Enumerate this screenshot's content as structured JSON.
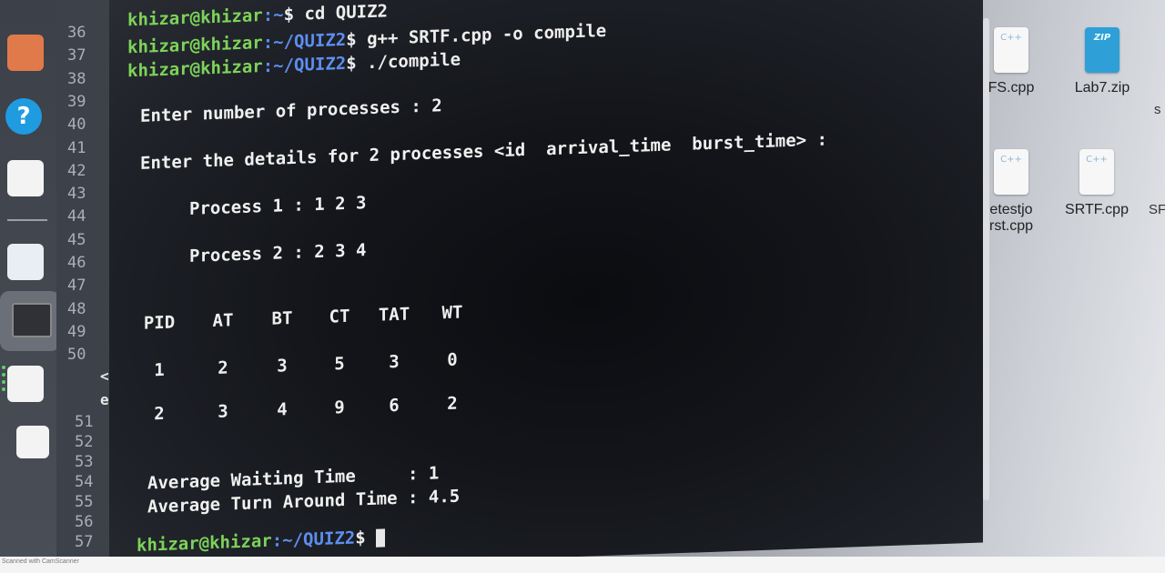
{
  "dock": {
    "help_icon_glyph": "?"
  },
  "gutter": {
    "line_numbers_top": [
      "36",
      "37",
      "38",
      "39",
      "40",
      "41",
      "42",
      "43",
      "44",
      "45",
      "46",
      "47",
      "48",
      "49",
      "50"
    ],
    "line_numbers_bottom": [
      "51",
      "52",
      "53",
      "54",
      "55",
      "56",
      "57"
    ],
    "frag1": "<<'",
    "frag2": "enc"
  },
  "terminal": {
    "line1_prompt": "khizar@khizar",
    "line1_path": ":~",
    "line1_cmd": "$ cd QUIZ2",
    "line2_prompt": "khizar@khizar",
    "line2_path": ":~/QUIZ2",
    "line2_cmd": "$ g++ SRTF.cpp -o compile",
    "line3_prompt": "khizar@khizar",
    "line3_path": ":~/QUIZ2",
    "line3_cmd": "$ ./compile",
    "enter_processes": "Enter number of processes : 2",
    "enter_details": "Enter the details for 2 processes <id  arrival_time  burst_time> :",
    "process1": "Process 1 : 1 2 3",
    "process2": "Process 2 : 2 3 4",
    "table": {
      "headers": [
        "PID",
        "AT",
        "BT",
        "CT",
        "TAT",
        "WT"
      ],
      "rows": [
        [
          "1",
          "2",
          "3",
          "5",
          "3",
          "0"
        ],
        [
          "2",
          "3",
          "4",
          "9",
          "6",
          "2"
        ]
      ]
    },
    "avg_wait_label": "Average Waiting Time",
    "avg_wait_value": ": 1",
    "avg_tat_label": "Average Turn Around Time",
    "avg_tat_value": ": 4.5",
    "final_prompt": "khizar@khizar",
    "final_path": ":~/QUIZ2",
    "final_dollar": "$"
  },
  "desktop": {
    "files": [
      {
        "name": "FS.cpp",
        "icon": "C++"
      },
      {
        "name": "Lab7.zip",
        "icon": "ZIP"
      },
      {
        "name": "etestjo\nrst.cpp",
        "icon": "C++"
      },
      {
        "name": "SRTF.cpp",
        "icon": "C++"
      }
    ],
    "partial_right_1": "s",
    "partial_right_2": "SF"
  },
  "watermark": "Scanned with CamScanner",
  "colors": {
    "prompt_green": "#7dd35a",
    "path_blue": "#5d8ef0",
    "terminal_bg": "#13151a"
  }
}
